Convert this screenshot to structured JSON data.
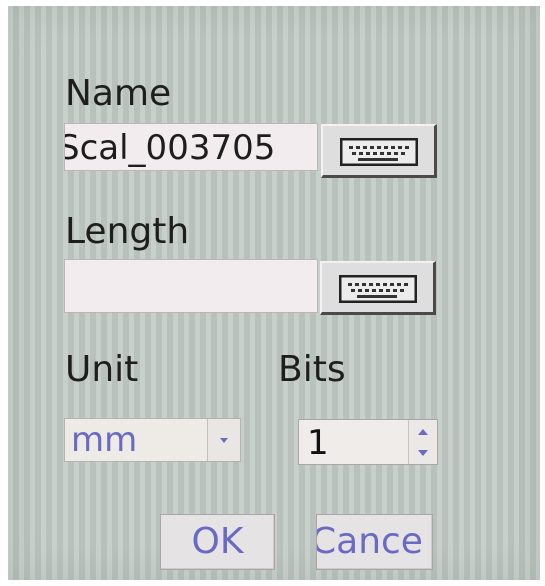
{
  "form": {
    "name_label": "Name",
    "name_value": "Scal_003705",
    "length_label": "Length",
    "length_value": "",
    "unit_label": "Unit",
    "unit_value": "mm",
    "bits_label": "Bits",
    "bits_value": "1",
    "ok_label": "OK",
    "cancel_label": "Cance"
  },
  "icons": {
    "keyboard": "keyboard-icon",
    "dropdown": "chevron-down-icon",
    "spin_up": "arrow-up-icon",
    "spin_down": "arrow-down-icon"
  },
  "colors": {
    "background": "#c2cbc5",
    "text": "#1e1e1e",
    "accent_text": "#6a6ac4",
    "field": "#f3ecee"
  }
}
